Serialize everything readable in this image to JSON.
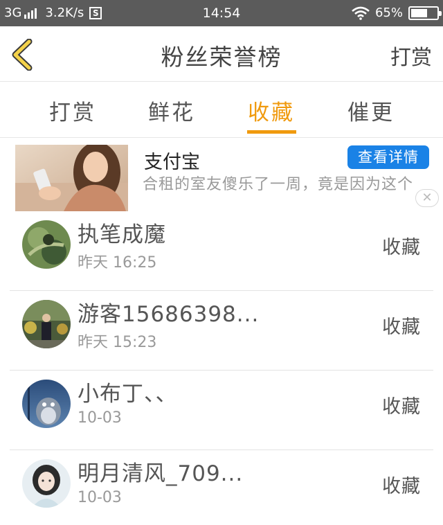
{
  "status_bar": {
    "network": "3G",
    "speed": "3.2K/s",
    "s_badge": "S",
    "time": "14:54",
    "battery_text": "65%",
    "battery_level": 0.65
  },
  "header": {
    "title": "粉丝荣誉榜",
    "right_button": "打赏"
  },
  "tabs": [
    {
      "label": "打赏",
      "active": false
    },
    {
      "label": "鲜花",
      "active": false
    },
    {
      "label": "收藏",
      "active": true
    },
    {
      "label": "催更",
      "active": false
    }
  ],
  "ad": {
    "name": "支付宝",
    "button": "查看详情",
    "description": "合租的室友傻乐了一周，竟是因为这个",
    "close": "✕"
  },
  "list": [
    {
      "name": "执笔成魔",
      "time": "昨天 16:25",
      "action": "收藏"
    },
    {
      "name": "游客15686398...",
      "time": "昨天 15:23",
      "action": "收藏"
    },
    {
      "name": "小布丁、、",
      "time": "10-03",
      "action": "收藏"
    },
    {
      "name": "明月清风_709...",
      "time": "10-03",
      "action": "收藏"
    }
  ],
  "colors": {
    "accent": "#f09a0e",
    "ad_button": "#1a82e6",
    "status_bar": "#5b5b5b"
  }
}
